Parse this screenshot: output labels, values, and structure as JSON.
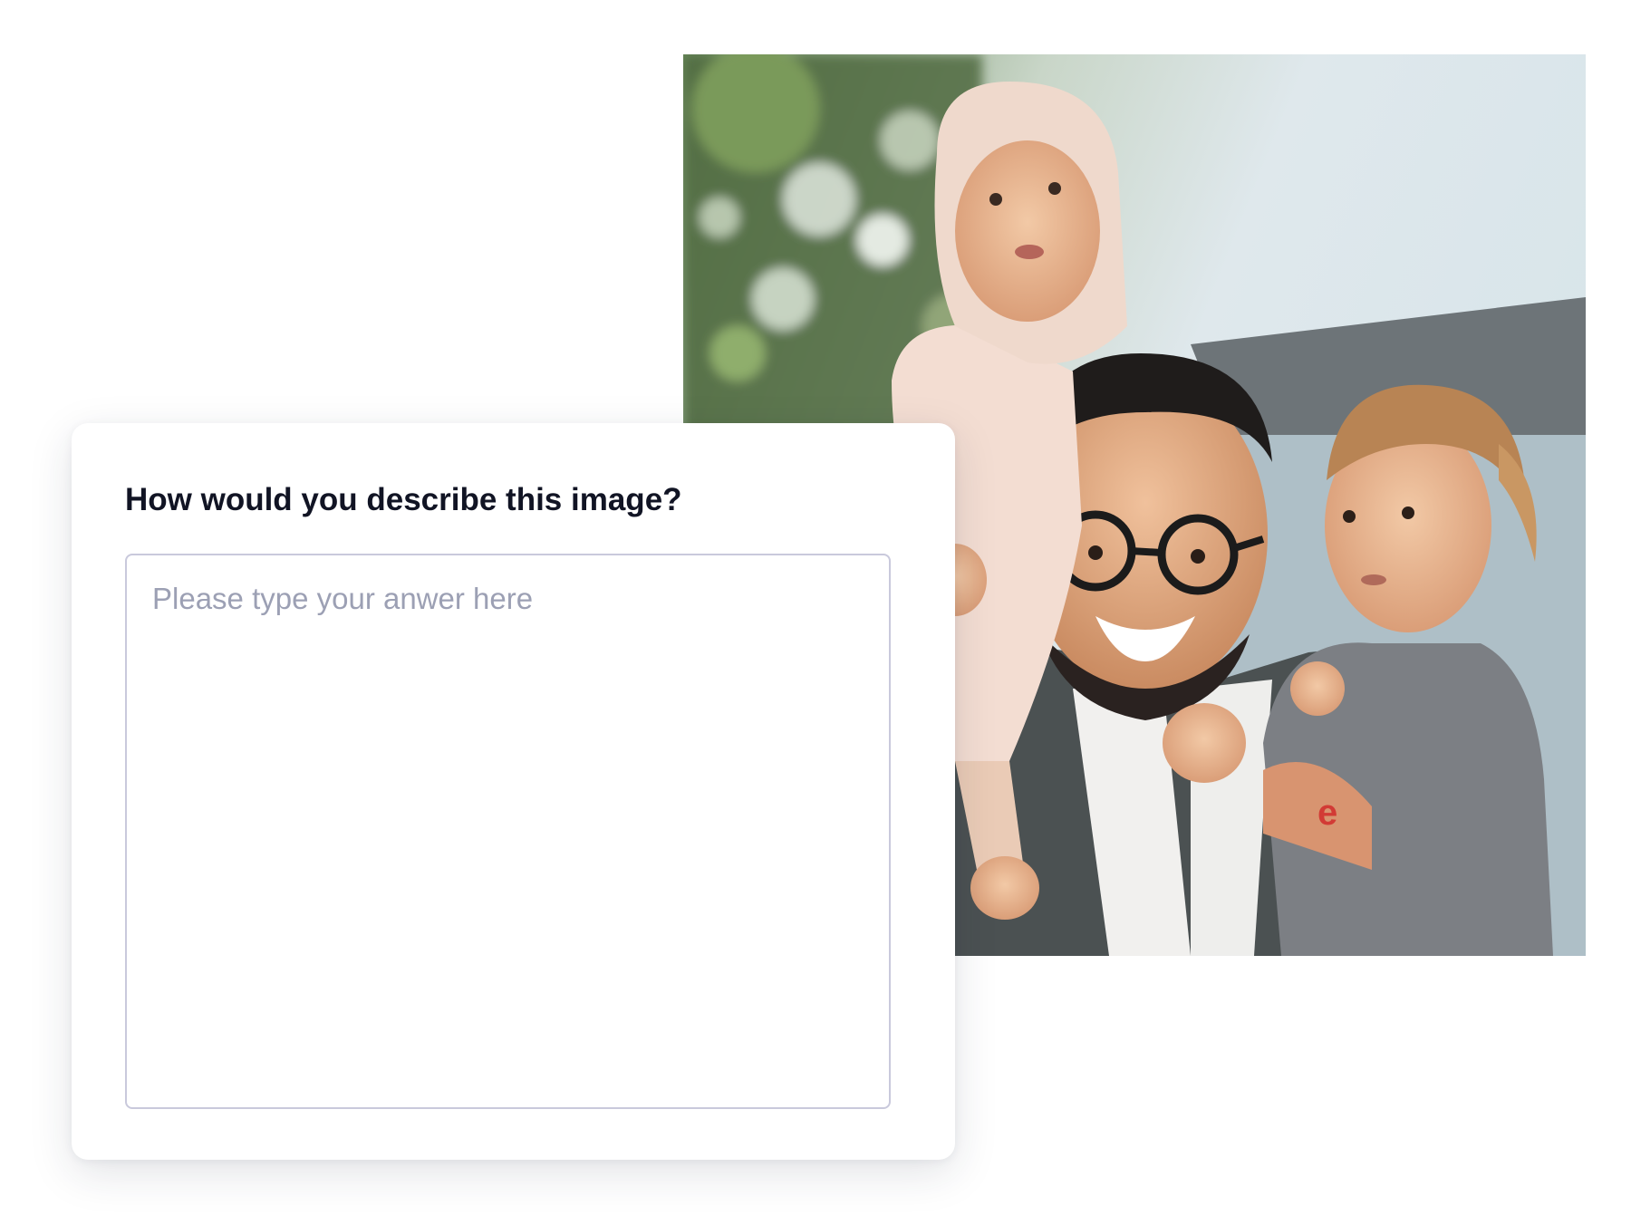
{
  "question": {
    "label": "How would you describe this image?"
  },
  "answer": {
    "value": "",
    "placeholder": "Please type your anwer here"
  },
  "photo": {
    "subject": "family-photo-image"
  }
}
